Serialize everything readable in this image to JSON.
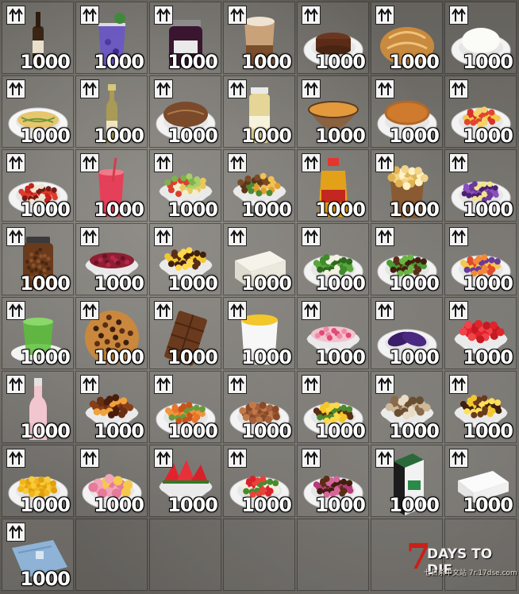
{
  "inventory": {
    "columns": 7,
    "rows": 8,
    "upgrade_icon": "double-up-arrow-icon",
    "items": [
      {
        "name": "beer",
        "icon": "beer-bottle-icon",
        "count": "1000"
      },
      {
        "name": "blueberry-drink",
        "icon": "purple-drink-icon",
        "count": "1000"
      },
      {
        "name": "blueberry-jam",
        "icon": "jam-jar-icon",
        "count": "1000"
      },
      {
        "name": "latte",
        "icon": "coffee-glass-icon",
        "count": "1000"
      },
      {
        "name": "chocolate-cake",
        "icon": "cake-icon",
        "count": "1000"
      },
      {
        "name": "bread",
        "icon": "bread-icon",
        "count": "1000"
      },
      {
        "name": "rice",
        "icon": "rice-bowl-icon",
        "count": "1000"
      },
      {
        "name": "noodles",
        "icon": "noodle-plate-icon",
        "count": "1000"
      },
      {
        "name": "champagne",
        "icon": "champagne-bottle-icon",
        "count": "1000"
      },
      {
        "name": "meat-pie",
        "icon": "pie-crust-icon",
        "count": "1000"
      },
      {
        "name": "juice",
        "icon": "juice-bottle-icon",
        "count": "1000"
      },
      {
        "name": "pumpkin-soup",
        "icon": "soup-pot-icon",
        "count": "1000"
      },
      {
        "name": "pumpkin-pie",
        "icon": "pumpkin-pie-icon",
        "count": "1000"
      },
      {
        "name": "tomato-egg",
        "icon": "tomato-egg-plate-icon",
        "count": "1000"
      },
      {
        "name": "chili-dish",
        "icon": "chili-plate-icon",
        "count": "1000"
      },
      {
        "name": "red-drink",
        "icon": "red-drink-icon",
        "count": "1000"
      },
      {
        "name": "salad",
        "icon": "salad-bowl-icon",
        "count": "1000"
      },
      {
        "name": "stew",
        "icon": "stew-bowl-icon",
        "count": "1000"
      },
      {
        "name": "cooking-oil",
        "icon": "oil-bottle-icon",
        "count": "1000"
      },
      {
        "name": "popcorn",
        "icon": "popcorn-bag-icon",
        "count": "1000"
      },
      {
        "name": "purple-rice",
        "icon": "purple-rice-plate-icon",
        "count": "1000"
      },
      {
        "name": "spice-jar",
        "icon": "spice-jar-icon",
        "count": "1000"
      },
      {
        "name": "borscht",
        "icon": "red-soup-bowl-icon",
        "count": "1000"
      },
      {
        "name": "beef-corn",
        "icon": "beef-corn-bowl-icon",
        "count": "1000"
      },
      {
        "name": "tofu",
        "icon": "tofu-block-icon",
        "count": "1000"
      },
      {
        "name": "green-beans",
        "icon": "green-beans-plate-icon",
        "count": "1000"
      },
      {
        "name": "beef-peppers",
        "icon": "beef-peppers-plate-icon",
        "count": "1000"
      },
      {
        "name": "mixed-veg",
        "icon": "mixed-veg-plate-icon",
        "count": "1000"
      },
      {
        "name": "green-tea",
        "icon": "green-tea-glass-icon",
        "count": "1000"
      },
      {
        "name": "cookie",
        "icon": "cookie-icon",
        "count": "1000"
      },
      {
        "name": "chocolate-bar",
        "icon": "chocolate-bar-icon",
        "count": "1000"
      },
      {
        "name": "custard",
        "icon": "custard-cup-icon",
        "count": "1000"
      },
      {
        "name": "fruit-soup",
        "icon": "fruit-soup-bowl-icon",
        "count": "1000"
      },
      {
        "name": "purple-corn",
        "icon": "purple-corn-plate-icon",
        "count": "1000"
      },
      {
        "name": "watermelon-cubes",
        "icon": "watermelon-bowl-icon",
        "count": "1000"
      },
      {
        "name": "rose-wine",
        "icon": "rose-bottle-icon",
        "count": "1000"
      },
      {
        "name": "braised-meat",
        "icon": "braised-meat-bowl-icon",
        "count": "1000"
      },
      {
        "name": "carrot-dish",
        "icon": "carrot-plate-icon",
        "count": "1000"
      },
      {
        "name": "peanuts",
        "icon": "peanut-plate-icon",
        "count": "1000"
      },
      {
        "name": "corn-stirfry",
        "icon": "corn-stirfry-plate-icon",
        "count": "1000"
      },
      {
        "name": "mushroom-stew",
        "icon": "mushroom-bowl-icon",
        "count": "1000"
      },
      {
        "name": "corn-salad",
        "icon": "corn-salad-bowl-icon",
        "count": "1000"
      },
      {
        "name": "corn-kernels",
        "icon": "corn-kernel-plate-icon",
        "count": "1000"
      },
      {
        "name": "pink-dumplings",
        "icon": "dumpling-plate-icon",
        "count": "1000"
      },
      {
        "name": "watermelon-slices",
        "icon": "watermelon-slice-bowl-icon",
        "count": "1000"
      },
      {
        "name": "tomato-salad",
        "icon": "tomato-salad-plate-icon",
        "count": "1000"
      },
      {
        "name": "onion-beef",
        "icon": "onion-beef-plate-icon",
        "count": "1000"
      },
      {
        "name": "milk-carton",
        "icon": "milk-carton-icon",
        "count": "1000"
      },
      {
        "name": "towel",
        "icon": "folded-towel-icon",
        "count": "1000"
      },
      {
        "name": "blue-cloth",
        "icon": "blue-cloth-icon",
        "count": "1000"
      },
      {
        "name": "",
        "icon": "",
        "count": ""
      },
      {
        "name": "",
        "icon": "",
        "count": ""
      },
      {
        "name": "",
        "icon": "",
        "count": ""
      },
      {
        "name": "",
        "icon": "",
        "count": ""
      },
      {
        "name": "",
        "icon": "",
        "count": ""
      },
      {
        "name": "",
        "icon": "",
        "count": ""
      }
    ]
  },
  "watermark": {
    "seven": "7",
    "title": "DAYS TO DIE",
    "subtitle": "七日杀中文站 7r.17dse.com"
  },
  "colors": {
    "logo_red": "#c8201a",
    "count_text": "#ffffff",
    "badge_bg": "#f4f4f4"
  }
}
